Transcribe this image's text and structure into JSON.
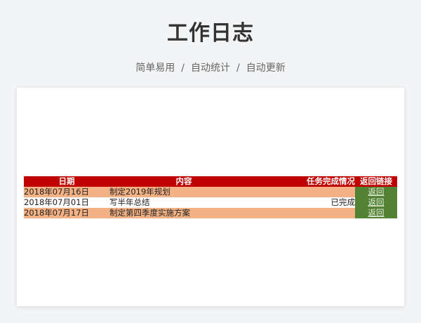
{
  "header": {
    "title": "工作日志",
    "tags": [
      "简单易用",
      "自动统计",
      "自动更新"
    ],
    "separator": "/"
  },
  "table": {
    "columns": [
      "日期",
      "内容",
      "任务完成情况",
      "返回链接"
    ],
    "rows": [
      {
        "date": "2018年07月16日",
        "content": "制定2019年规划",
        "status": "",
        "link": "返回"
      },
      {
        "date": "2018年07月01日",
        "content": "写半年总结",
        "status": "已完成",
        "link": "返回"
      },
      {
        "date": "2018年07月17日",
        "content": "制定第四季度实施方案",
        "status": "",
        "link": "返回"
      }
    ]
  },
  "colors": {
    "header_bg": "#c00000",
    "row_accent": "#f4b183",
    "link_bg": "#548235"
  }
}
